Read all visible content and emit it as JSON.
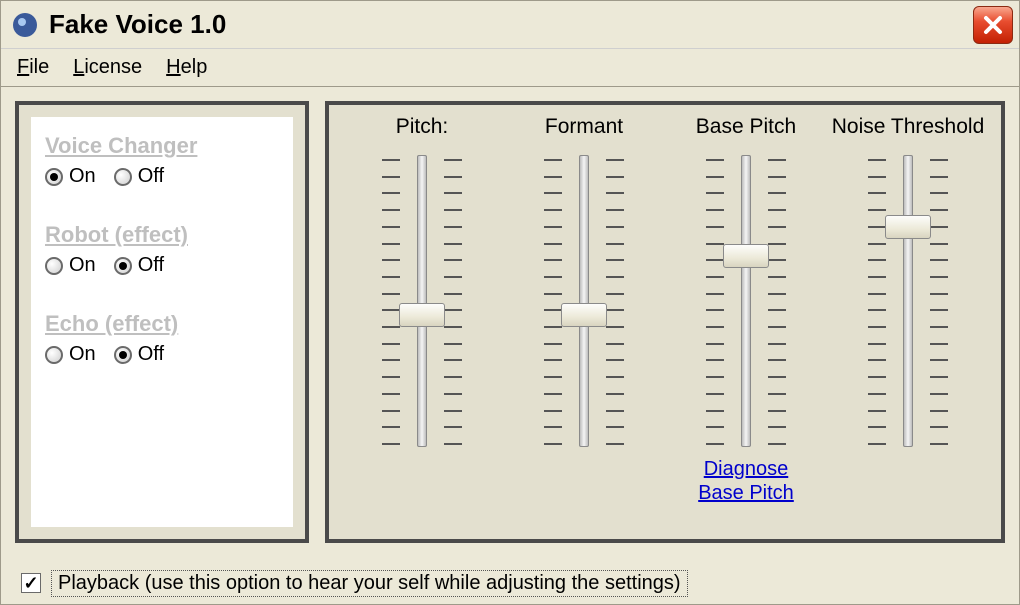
{
  "window": {
    "title": "Fake Voice 1.0"
  },
  "menu": {
    "file": "File",
    "license": "License",
    "help": "Help"
  },
  "effects": {
    "voice_changer": {
      "title": "Voice Changer",
      "on": "On",
      "off": "Off",
      "value": "on"
    },
    "robot": {
      "title": "Robot (effect)",
      "on": "On",
      "off": "Off",
      "value": "off"
    },
    "echo": {
      "title": "Echo (effect)",
      "on": "On",
      "off": "Off",
      "value": "off"
    }
  },
  "sliders": {
    "pitch": {
      "label": "Pitch:",
      "value_pct": 55
    },
    "formant": {
      "label": "Formant",
      "value_pct": 55
    },
    "base_pitch": {
      "label": "Base Pitch",
      "value_pct": 34,
      "link": "Diagnose \nBase Pitch"
    },
    "noise": {
      "label": "Noise Threshold",
      "value_pct": 24
    }
  },
  "playback": {
    "checked": true,
    "label": "Playback (use this option to hear your self while adjusting the settings)"
  }
}
